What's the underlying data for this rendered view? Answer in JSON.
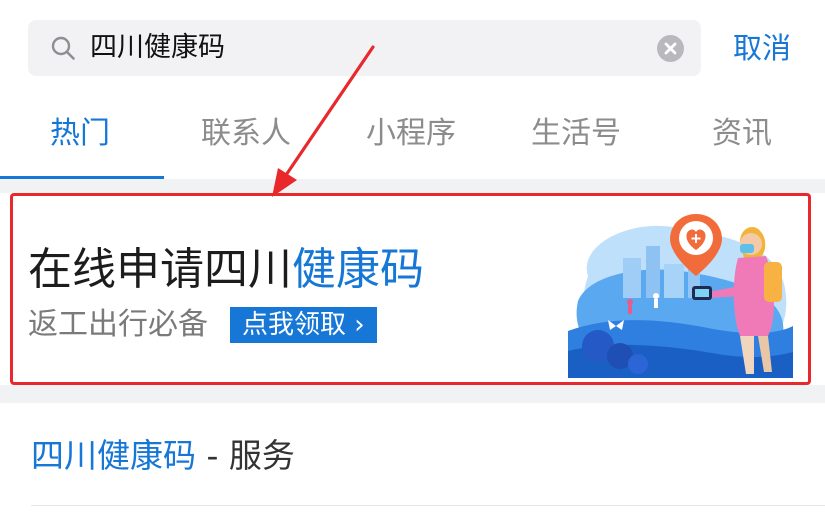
{
  "search": {
    "query": "四川健康码",
    "cancel_label": "取消"
  },
  "tabs": [
    {
      "label": "热门",
      "active": true
    },
    {
      "label": "联系人",
      "active": false
    },
    {
      "label": "小程序",
      "active": false
    },
    {
      "label": "生活号",
      "active": false
    },
    {
      "label": "资讯",
      "active": false
    }
  ],
  "banner": {
    "title_part1": "在线申请四川",
    "title_part2": "健康码",
    "subtitle": "返工出行必备",
    "cta_label": "点我领取",
    "cta_chevron": "›"
  },
  "result": {
    "name": "四川健康码",
    "suffix": " - 服务"
  },
  "colors": {
    "accent": "#1677d6",
    "annotation": "#e8282b"
  },
  "icons": [
    "search-icon",
    "clear-icon",
    "chevron-right-icon",
    "heart-plus-icon",
    "arrow-annotation-icon"
  ]
}
